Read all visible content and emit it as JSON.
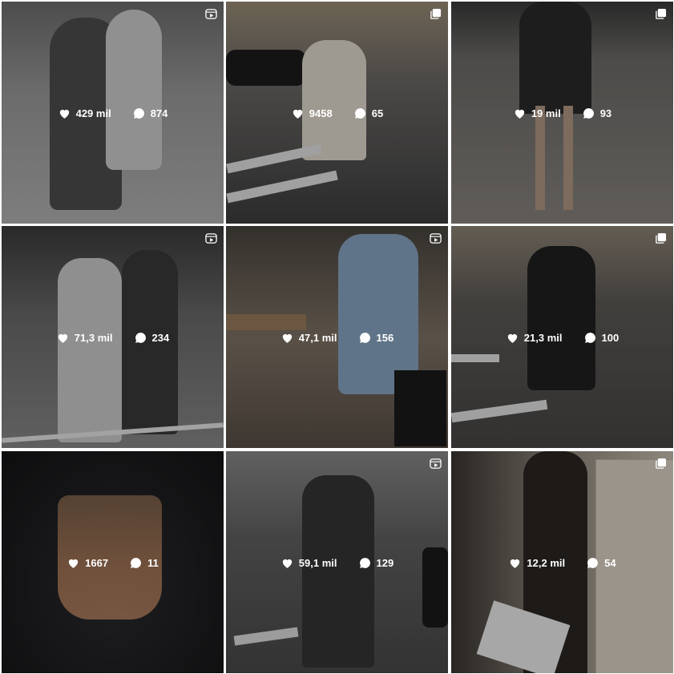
{
  "posts": [
    {
      "likes": "429 mil",
      "comments": "874",
      "badge": "reel-icon",
      "bg": "#8c8c8c"
    },
    {
      "likes": "9458",
      "comments": "65",
      "badge": "multiple-icon",
      "bg": "#5b5650"
    },
    {
      "likes": "19 mil",
      "comments": "93",
      "badge": "multiple-icon",
      "bg": "#5a5754"
    },
    {
      "likes": "71,3 mil",
      "comments": "234",
      "badge": "reel-icon",
      "bg": "#6f6f6f"
    },
    {
      "likes": "47,1 mil",
      "comments": "156",
      "badge": "reel-icon",
      "bg": "#57524b"
    },
    {
      "likes": "21,3 mil",
      "comments": "100",
      "badge": "multiple-icon",
      "bg": "#545454"
    },
    {
      "likes": "1667",
      "comments": "11",
      "badge": "",
      "bg": "#1f1f22"
    },
    {
      "likes": "59,1 mil",
      "comments": "129",
      "badge": "reel-icon",
      "bg": "#585858"
    },
    {
      "likes": "12,2 mil",
      "comments": "54",
      "badge": "multiple-icon",
      "bg": "#6e6a63"
    }
  ]
}
